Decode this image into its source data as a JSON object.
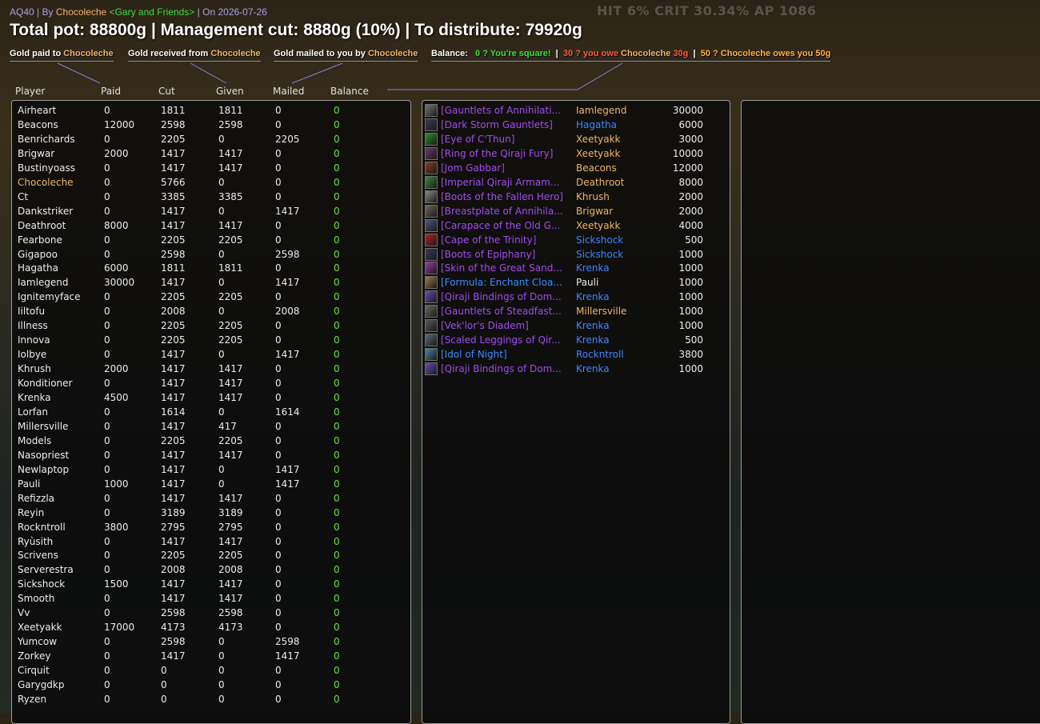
{
  "background_stats": "HIT 6%  CRIT  30.34%   AP 1086",
  "header": {
    "raid": "AQ40",
    "by_label": "By",
    "leader": "Chocoleche",
    "guild": "<Gary and Friends>",
    "date_label": "On 2026-07-26",
    "separator": "|",
    "title": "Total pot: 88800g | Management cut: 8880g (10%) | To distribute: 79920g"
  },
  "legends": {
    "paid": {
      "text": "Gold paid to",
      "name": "Chocoleche"
    },
    "received": {
      "text": "Gold received from",
      "name": "Chocoleche"
    },
    "mailed": {
      "text": "Gold mailed to you by",
      "name": "Chocoleche"
    },
    "balance": {
      "label": "Balance:",
      "square": "0 ? You're square!",
      "sep": "|",
      "owe_prefix": "30 ? you owe",
      "owe_name": "Chocoleche",
      "owe_amount": "30g",
      "owed_text": "50 ? Chocoleche owes you 50g"
    }
  },
  "columns": [
    "Player",
    "Paid",
    "Cut",
    "Given",
    "Mailed",
    "Balance"
  ],
  "players": [
    {
      "name": "Airheart",
      "paid": "0",
      "cut": "1811",
      "given": "1811",
      "mailed": "0",
      "balance": "0"
    },
    {
      "name": "Beacons",
      "paid": "12000",
      "cut": "2598",
      "given": "2598",
      "mailed": "0",
      "balance": "0"
    },
    {
      "name": "Benrichards",
      "paid": "0",
      "cut": "2205",
      "given": "0",
      "mailed": "2205",
      "balance": "0"
    },
    {
      "name": "Brigwar",
      "paid": "2000",
      "cut": "1417",
      "given": "1417",
      "mailed": "0",
      "balance": "0"
    },
    {
      "name": "Bustinyoass",
      "paid": "0",
      "cut": "1417",
      "given": "1417",
      "mailed": "0",
      "balance": "0"
    },
    {
      "name": "Chocoleche",
      "paid": "0",
      "cut": "5766",
      "given": "0",
      "mailed": "0",
      "balance": "0",
      "self": true
    },
    {
      "name": "Ct",
      "paid": "0",
      "cut": "3385",
      "given": "3385",
      "mailed": "0",
      "balance": "0"
    },
    {
      "name": "Dankstriker",
      "paid": "0",
      "cut": "1417",
      "given": "0",
      "mailed": "1417",
      "balance": "0"
    },
    {
      "name": "Deathroot",
      "paid": "8000",
      "cut": "1417",
      "given": "1417",
      "mailed": "0",
      "balance": "0"
    },
    {
      "name": "Fearbone",
      "paid": "0",
      "cut": "2205",
      "given": "2205",
      "mailed": "0",
      "balance": "0"
    },
    {
      "name": "Gigapoo",
      "paid": "0",
      "cut": "2598",
      "given": "0",
      "mailed": "2598",
      "balance": "0"
    },
    {
      "name": "Hagatha",
      "paid": "6000",
      "cut": "1811",
      "given": "1811",
      "mailed": "0",
      "balance": "0"
    },
    {
      "name": "Iamlegend",
      "paid": "30000",
      "cut": "1417",
      "given": "0",
      "mailed": "1417",
      "balance": "0"
    },
    {
      "name": "Ignitemyface",
      "paid": "0",
      "cut": "2205",
      "given": "2205",
      "mailed": "0",
      "balance": "0"
    },
    {
      "name": "Iiltofu",
      "paid": "0",
      "cut": "2008",
      "given": "0",
      "mailed": "2008",
      "balance": "0"
    },
    {
      "name": "Illness",
      "paid": "0",
      "cut": "2205",
      "given": "2205",
      "mailed": "0",
      "balance": "0"
    },
    {
      "name": "Innova",
      "paid": "0",
      "cut": "2205",
      "given": "2205",
      "mailed": "0",
      "balance": "0"
    },
    {
      "name": "Iolbye",
      "paid": "0",
      "cut": "1417",
      "given": "0",
      "mailed": "1417",
      "balance": "0"
    },
    {
      "name": "Khrush",
      "paid": "2000",
      "cut": "1417",
      "given": "1417",
      "mailed": "0",
      "balance": "0"
    },
    {
      "name": "Konditioner",
      "paid": "0",
      "cut": "1417",
      "given": "1417",
      "mailed": "0",
      "balance": "0"
    },
    {
      "name": "Krenka",
      "paid": "4500",
      "cut": "1417",
      "given": "1417",
      "mailed": "0",
      "balance": "0"
    },
    {
      "name": "Lorfan",
      "paid": "0",
      "cut": "1614",
      "given": "0",
      "mailed": "1614",
      "balance": "0"
    },
    {
      "name": "Millersville",
      "paid": "0",
      "cut": "1417",
      "given": "417",
      "mailed": "0",
      "balance": "0"
    },
    {
      "name": "Models",
      "paid": "0",
      "cut": "2205",
      "given": "2205",
      "mailed": "0",
      "balance": "0"
    },
    {
      "name": "Nasopriest",
      "paid": "0",
      "cut": "1417",
      "given": "1417",
      "mailed": "0",
      "balance": "0"
    },
    {
      "name": "Newlaptop",
      "paid": "0",
      "cut": "1417",
      "given": "0",
      "mailed": "1417",
      "balance": "0"
    },
    {
      "name": "Pauli",
      "paid": "1000",
      "cut": "1417",
      "given": "0",
      "mailed": "1417",
      "balance": "0"
    },
    {
      "name": "Refizzla",
      "paid": "0",
      "cut": "1417",
      "given": "1417",
      "mailed": "0",
      "balance": "0"
    },
    {
      "name": "Reyin",
      "paid": "0",
      "cut": "3189",
      "given": "3189",
      "mailed": "0",
      "balance": "0"
    },
    {
      "name": "Rockntroll",
      "paid": "3800",
      "cut": "2795",
      "given": "2795",
      "mailed": "0",
      "balance": "0"
    },
    {
      "name": "Ryùsith",
      "paid": "0",
      "cut": "1417",
      "given": "1417",
      "mailed": "0",
      "balance": "0"
    },
    {
      "name": "Scrivens",
      "paid": "0",
      "cut": "2205",
      "given": "2205",
      "mailed": "0",
      "balance": "0"
    },
    {
      "name": "Serverestra",
      "paid": "0",
      "cut": "2008",
      "given": "2008",
      "mailed": "0",
      "balance": "0"
    },
    {
      "name": "Sickshock",
      "paid": "1500",
      "cut": "1417",
      "given": "1417",
      "mailed": "0",
      "balance": "0"
    },
    {
      "name": "Smooth",
      "paid": "0",
      "cut": "1417",
      "given": "1417",
      "mailed": "0",
      "balance": "0"
    },
    {
      "name": "Vv",
      "paid": "0",
      "cut": "2598",
      "given": "2598",
      "mailed": "0",
      "balance": "0"
    },
    {
      "name": "Xeetyakk",
      "paid": "17000",
      "cut": "4173",
      "given": "4173",
      "mailed": "0",
      "balance": "0"
    },
    {
      "name": "Yumcow",
      "paid": "0",
      "cut": "2598",
      "given": "0",
      "mailed": "2598",
      "balance": "0"
    },
    {
      "name": "Zorkey",
      "paid": "0",
      "cut": "1417",
      "given": "0",
      "mailed": "1417",
      "balance": "0"
    },
    {
      "name": "Cirquit",
      "paid": "0",
      "cut": "0",
      "given": "0",
      "mailed": "0",
      "balance": "0"
    },
    {
      "name": "Garygdkp",
      "paid": "0",
      "cut": "0",
      "given": "0",
      "mailed": "0",
      "balance": "0"
    },
    {
      "name": "Ryzen",
      "paid": "0",
      "cut": "0",
      "given": "0",
      "mailed": "0",
      "balance": "0"
    }
  ],
  "loot": [
    {
      "item": "[Gauntlets of Annihilati...",
      "rarity": "epic",
      "winner": "Iamlegend",
      "cls": "rogue",
      "price": "30000",
      "icon": "gauntlet-icon",
      "icolor": "#777777"
    },
    {
      "item": "[Dark Storm Gauntlets]",
      "rarity": "epic",
      "winner": "Hagatha",
      "cls": "mage",
      "price": "6000",
      "icon": "gauntlet-icon",
      "icolor": "#3a3a5a"
    },
    {
      "item": "[Eye of C'Thun]",
      "rarity": "epic",
      "winner": "Xeetyakk",
      "cls": "rogue",
      "price": "3000",
      "icon": "eye-icon",
      "icolor": "#2f8a2f"
    },
    {
      "item": "[Ring of the Qiraji Fury]",
      "rarity": "epic",
      "winner": "Xeetyakk",
      "cls": "rogue",
      "price": "10000",
      "icon": "ring-icon",
      "icolor": "#6a3a6a"
    },
    {
      "item": "[Jom Gabbar]",
      "rarity": "epic",
      "winner": "Beacons",
      "cls": "rogue",
      "price": "12000",
      "icon": "trinket-icon",
      "icolor": "#8a3a2a"
    },
    {
      "item": "[Imperial Qiraji Armam...",
      "rarity": "epic",
      "winner": "Deathroot",
      "cls": "rogue",
      "price": "8000",
      "icon": "armament-icon",
      "icolor": "#3a8a3a"
    },
    {
      "item": "[Boots of the Fallen Hero]",
      "rarity": "epic",
      "winner": "Khrush",
      "cls": "rogue",
      "price": "2000",
      "icon": "boots-icon",
      "icolor": "#8a8a8a"
    },
    {
      "item": "[Breastplate of Annihila...",
      "rarity": "epic",
      "winner": "Brigwar",
      "cls": "rogue",
      "price": "2000",
      "icon": "breastplate-icon",
      "icolor": "#6a6a55"
    },
    {
      "item": "[Carapace of the Old G...",
      "rarity": "epic",
      "winner": "Xeetyakk",
      "cls": "rogue",
      "price": "4000",
      "icon": "carapace-icon",
      "icolor": "#4a5a7a"
    },
    {
      "item": "[Cape of the Trinity]",
      "rarity": "epic",
      "winner": "Sickshock",
      "cls": "mage",
      "price": "500",
      "icon": "cape-icon",
      "icolor": "#b52020"
    },
    {
      "item": "[Boots of Epiphany]",
      "rarity": "epic",
      "winner": "Sickshock",
      "cls": "mage",
      "price": "1000",
      "icon": "boots-icon",
      "icolor": "#3a3a5a"
    },
    {
      "item": "[Skin of the Great Sand...",
      "rarity": "epic",
      "winner": "Krenka",
      "cls": "mage",
      "price": "1000",
      "icon": "skin-icon",
      "icolor": "#9a3aa0"
    },
    {
      "item": "[Formula: Enchant Cloa...",
      "rarity": "blue",
      "winner": "Pauli",
      "cls": "priest",
      "price": "1000",
      "icon": "scroll-icon",
      "icolor": "#a07a4a"
    },
    {
      "item": "[Qiraji Bindings of Dom...",
      "rarity": "epic",
      "winner": "Krenka",
      "cls": "mage",
      "price": "1000",
      "icon": "bindings-icon",
      "icolor": "#6a4ab5"
    },
    {
      "item": "[Gauntlets of Steadfast...",
      "rarity": "epic",
      "winner": "Millersville",
      "cls": "rogue",
      "price": "1000",
      "icon": "gauntlet-icon",
      "icolor": "#6a6a55"
    },
    {
      "item": "[Vek'lor's Diadem]",
      "rarity": "epic",
      "winner": "Krenka",
      "cls": "mage",
      "price": "1000",
      "icon": "diadem-icon",
      "icolor": "#5a5a5a"
    },
    {
      "item": "[Scaled Leggings of Qir...",
      "rarity": "epic",
      "winner": "Krenka",
      "cls": "mage",
      "price": "500",
      "icon": "leggings-icon",
      "icolor": "#5a6a7a"
    },
    {
      "item": "[Idol of Night]",
      "rarity": "blue",
      "winner": "Rockntroll",
      "cls": "mage",
      "price": "3800",
      "icon": "idol-icon",
      "icolor": "#4a8aa0"
    },
    {
      "item": "[Qiraji Bindings of Dom...",
      "rarity": "epic",
      "winner": "Krenka",
      "cls": "mage",
      "price": "1000",
      "icon": "bindings-icon",
      "icolor": "#6a4ab5"
    }
  ]
}
